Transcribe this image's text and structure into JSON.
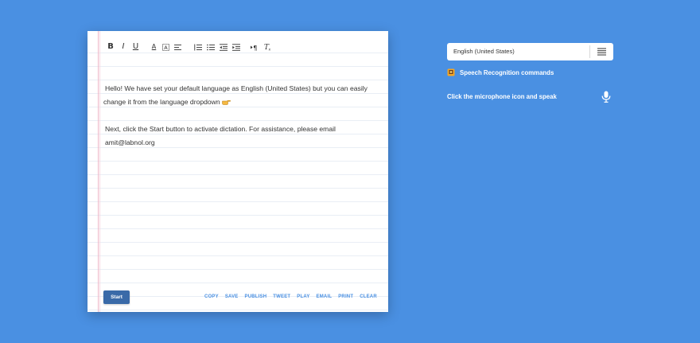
{
  "toolbar": {
    "bold": "B",
    "italic": "I",
    "underline": "U",
    "font_color": "A"
  },
  "editor": {
    "paragraph1": "Hello!  We have set your default language as  English (United States) but you can easily change it from the language dropdown",
    "paragraph2": "Next, click the Start button to activate dictation.  For assistance,  please email amit@labnol.org"
  },
  "start_button": "Start",
  "actions": [
    "COPY",
    "SAVE",
    "PUBLISH",
    "TWEET",
    "PLAY",
    "EMAIL",
    "PRINT",
    "CLEAR"
  ],
  "language_select": {
    "value": "English (United States)"
  },
  "commands_link": "Speech Recognition commands",
  "hint": "Click the microphone icon and speak",
  "colors": {
    "background": "#4a90e2",
    "start_button": "#3a6aa8",
    "action_links": "#4a90e2"
  },
  "icons": {
    "pointing_hand": "pointing-hand-icon",
    "commands": "commands-emoji-icon",
    "microphone": "microphone-icon",
    "menu": "hamburger-menu-icon"
  }
}
